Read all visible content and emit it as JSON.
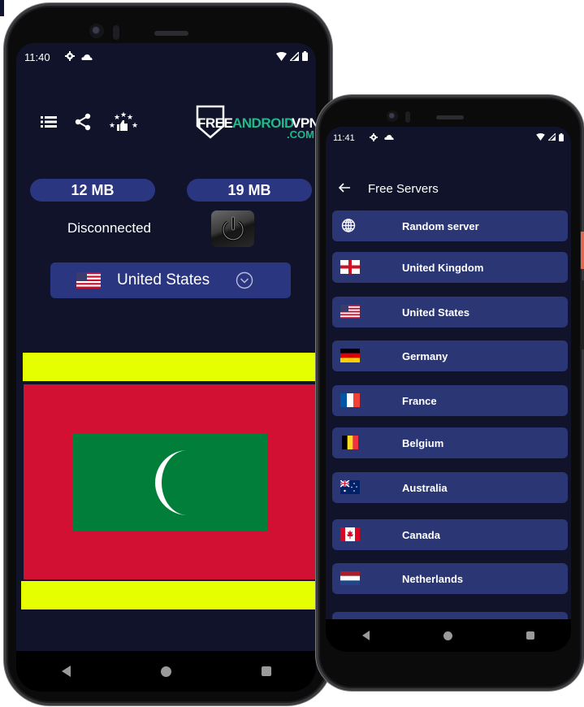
{
  "phone_main": {
    "status_bar": {
      "time": "11:40",
      "icons": [
        "gear-icon",
        "cloud-icon",
        "wifi-icon",
        "signal-icon",
        "battery-icon"
      ]
    },
    "toolbar": {
      "icons": [
        "list-icon",
        "share-icon",
        "rate-stars-thumb-icon"
      ]
    },
    "logo": {
      "free": "FREE",
      "android": "ANDROID",
      "vpn": "VPN",
      "com": ".COM"
    },
    "stats": {
      "download": "12 MB",
      "upload": "19 MB"
    },
    "connection_status": "Disconnected",
    "power_button": {
      "icon": "power-icon"
    },
    "country_selector": {
      "flag": "us-flag",
      "label": "United States",
      "icon": "chevron-down-circle-icon"
    },
    "featured_flag": {
      "name": "maldives-style-flag",
      "colors": {
        "band": "#e6ff00",
        "field": "#d21034",
        "center": "#007e3a",
        "crescent": "#ffffff"
      }
    },
    "nav": [
      "back",
      "home",
      "recents"
    ]
  },
  "phone_servers": {
    "status_bar": {
      "time": "11:41",
      "icons": [
        "gear-icon",
        "cloud-icon",
        "wifi-icon",
        "signal-icon",
        "battery-icon"
      ]
    },
    "appbar": {
      "back_icon": "arrow-left-icon",
      "title": "Free Servers"
    },
    "servers": [
      {
        "name": "Random server",
        "flag": "globe"
      },
      {
        "name": "United Kingdom",
        "flag": "gb"
      },
      {
        "name": "United States",
        "flag": "us"
      },
      {
        "name": "Germany",
        "flag": "de"
      },
      {
        "name": "France",
        "flag": "fr"
      },
      {
        "name": "Belgium",
        "flag": "be"
      },
      {
        "name": "Australia",
        "flag": "au"
      },
      {
        "name": "Canada",
        "flag": "ca"
      },
      {
        "name": "Netherlands",
        "flag": "nl"
      }
    ],
    "nav": [
      "back",
      "home",
      "recents"
    ]
  },
  "colors": {
    "background": "#10132a",
    "accent": "#2b3680",
    "logo_green": "#1fb98a"
  }
}
